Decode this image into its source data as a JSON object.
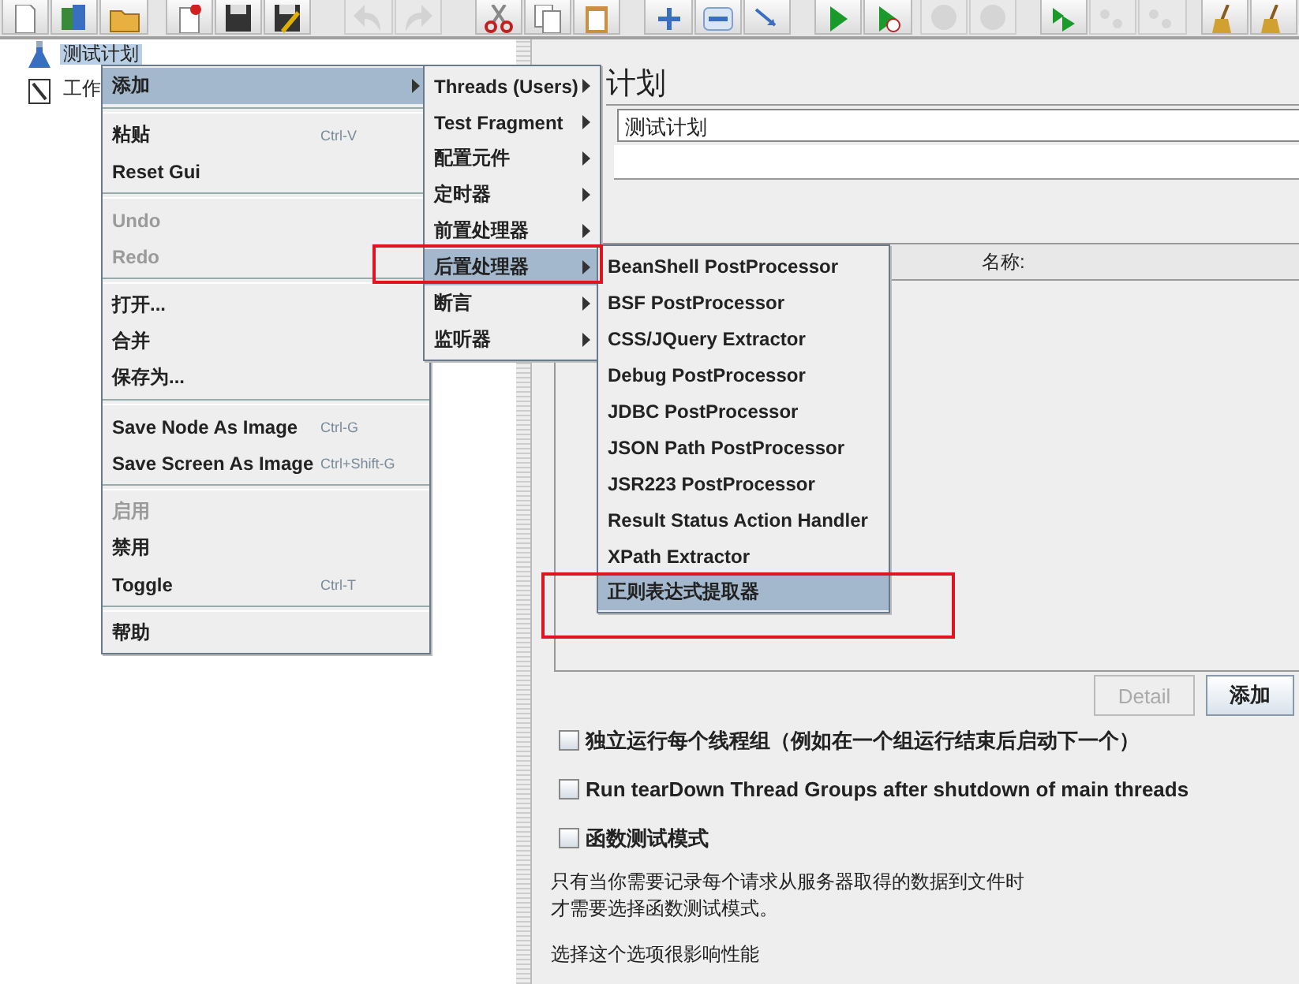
{
  "toolbar": [
    {
      "disabled": false
    },
    {
      "disabled": false
    },
    {
      "disabled": false
    },
    {
      "disabled": false
    },
    {
      "disabled": false
    },
    {
      "disabled": false
    },
    {
      "disabled": true
    },
    {
      "disabled": true
    },
    {
      "disabled": false
    },
    {
      "disabled": false
    },
    {
      "disabled": false
    },
    {
      "disabled": false
    },
    {
      "disabled": false
    },
    {
      "disabled": false
    },
    {
      "disabled": false
    },
    {
      "disabled": false
    },
    {
      "disabled": true
    },
    {
      "disabled": true
    },
    {
      "disabled": false
    },
    {
      "disabled": true
    },
    {
      "disabled": true
    },
    {
      "disabled": false
    },
    {
      "disabled": false
    }
  ],
  "tree": {
    "items": [
      {
        "label": "测试计划",
        "selected": true,
        "kind": "plan"
      },
      {
        "label": "工作",
        "selected": false,
        "kind": "workbench"
      }
    ]
  },
  "test_plan": {
    "title": "计划",
    "name_field": {
      "value": "测试计划"
    },
    "variables_table": {
      "columns": [
        "名称:"
      ]
    },
    "buttons": [
      {
        "label": "Detail",
        "disabled": true
      },
      {
        "label": "添加",
        "disabled": false
      }
    ],
    "options": [
      {
        "label": "独立运行每个线程组（例如在一个组运行结束后启动下一个）",
        "checked": false
      },
      {
        "label": "Run tearDown Thread Groups after shutdown of main threads",
        "checked": false
      },
      {
        "label": "函数测试模式",
        "checked": false
      }
    ],
    "note_lines": [
      "只有当你需要记录每个请求从服务器取得的数据到文件时",
      "才需要选择函数测试模式。",
      "选择这个选项很影响性能"
    ]
  },
  "context_menu": {
    "items": [
      {
        "kind": "item",
        "label": "添加",
        "submenu": true,
        "selected": true,
        "disabled": false
      },
      {
        "kind": "separator"
      },
      {
        "kind": "item",
        "label": "粘贴",
        "shortcut": "Ctrl-V",
        "selected": false,
        "disabled": false
      },
      {
        "kind": "item",
        "label": "Reset Gui",
        "selected": false,
        "disabled": false
      },
      {
        "kind": "separator"
      },
      {
        "kind": "item",
        "label": "Undo",
        "selected": false,
        "disabled": true
      },
      {
        "kind": "item",
        "label": "Redo",
        "selected": false,
        "disabled": true
      },
      {
        "kind": "separator"
      },
      {
        "kind": "item",
        "label": "打开...",
        "selected": false,
        "disabled": false
      },
      {
        "kind": "item",
        "label": "合并",
        "selected": false,
        "disabled": false
      },
      {
        "kind": "item",
        "label": "保存为...",
        "selected": false,
        "disabled": false
      },
      {
        "kind": "separator"
      },
      {
        "kind": "item",
        "label": "Save Node As Image",
        "shortcut": "Ctrl-G",
        "selected": false,
        "disabled": false
      },
      {
        "kind": "item",
        "label": "Save Screen As Image",
        "shortcut": "Ctrl+Shift-G",
        "selected": false,
        "disabled": false
      },
      {
        "kind": "separator"
      },
      {
        "kind": "item",
        "label": "启用",
        "selected": false,
        "disabled": true
      },
      {
        "kind": "item",
        "label": "禁用",
        "selected": false,
        "disabled": false
      },
      {
        "kind": "item",
        "label": "Toggle",
        "shortcut": "Ctrl-T",
        "selected": false,
        "disabled": false
      },
      {
        "kind": "separator"
      },
      {
        "kind": "item",
        "label": "帮助",
        "selected": false,
        "disabled": false
      }
    ]
  },
  "add_submenu": {
    "items": [
      {
        "kind": "item",
        "label": "Threads (Users)",
        "submenu": true,
        "selected": false,
        "disabled": false
      },
      {
        "kind": "item",
        "label": "Test Fragment",
        "submenu": true,
        "selected": false,
        "disabled": false
      },
      {
        "kind": "item",
        "label": "配置元件",
        "submenu": true,
        "selected": false,
        "disabled": false
      },
      {
        "kind": "item",
        "label": "定时器",
        "submenu": true,
        "selected": false,
        "disabled": false
      },
      {
        "kind": "item",
        "label": "前置处理器",
        "submenu": true,
        "selected": false,
        "disabled": false
      },
      {
        "kind": "item",
        "label": "后置处理器",
        "submenu": true,
        "selected": true,
        "disabled": false
      },
      {
        "kind": "item",
        "label": "断言",
        "submenu": true,
        "selected": false,
        "disabled": false
      },
      {
        "kind": "item",
        "label": "监听器",
        "submenu": true,
        "selected": false,
        "disabled": false
      }
    ]
  },
  "postprocessor_submenu": {
    "items": [
      {
        "kind": "item",
        "label": "BeanShell PostProcessor",
        "selected": false,
        "disabled": false
      },
      {
        "kind": "item",
        "label": "BSF PostProcessor",
        "selected": false,
        "disabled": false
      },
      {
        "kind": "item",
        "label": "CSS/JQuery Extractor",
        "selected": false,
        "disabled": false
      },
      {
        "kind": "item",
        "label": "Debug PostProcessor",
        "selected": false,
        "disabled": false
      },
      {
        "kind": "item",
        "label": "JDBC PostProcessor",
        "selected": false,
        "disabled": false
      },
      {
        "kind": "item",
        "label": "JSON Path PostProcessor",
        "selected": false,
        "disabled": false
      },
      {
        "kind": "item",
        "label": "JSR223 PostProcessor",
        "selected": false,
        "disabled": false
      },
      {
        "kind": "item",
        "label": "Result Status Action Handler",
        "selected": false,
        "disabled": false
      },
      {
        "kind": "item",
        "label": "XPath Extractor",
        "selected": false,
        "disabled": false
      },
      {
        "kind": "item",
        "label": "正则表达式提取器",
        "selected": true,
        "disabled": false
      }
    ]
  }
}
